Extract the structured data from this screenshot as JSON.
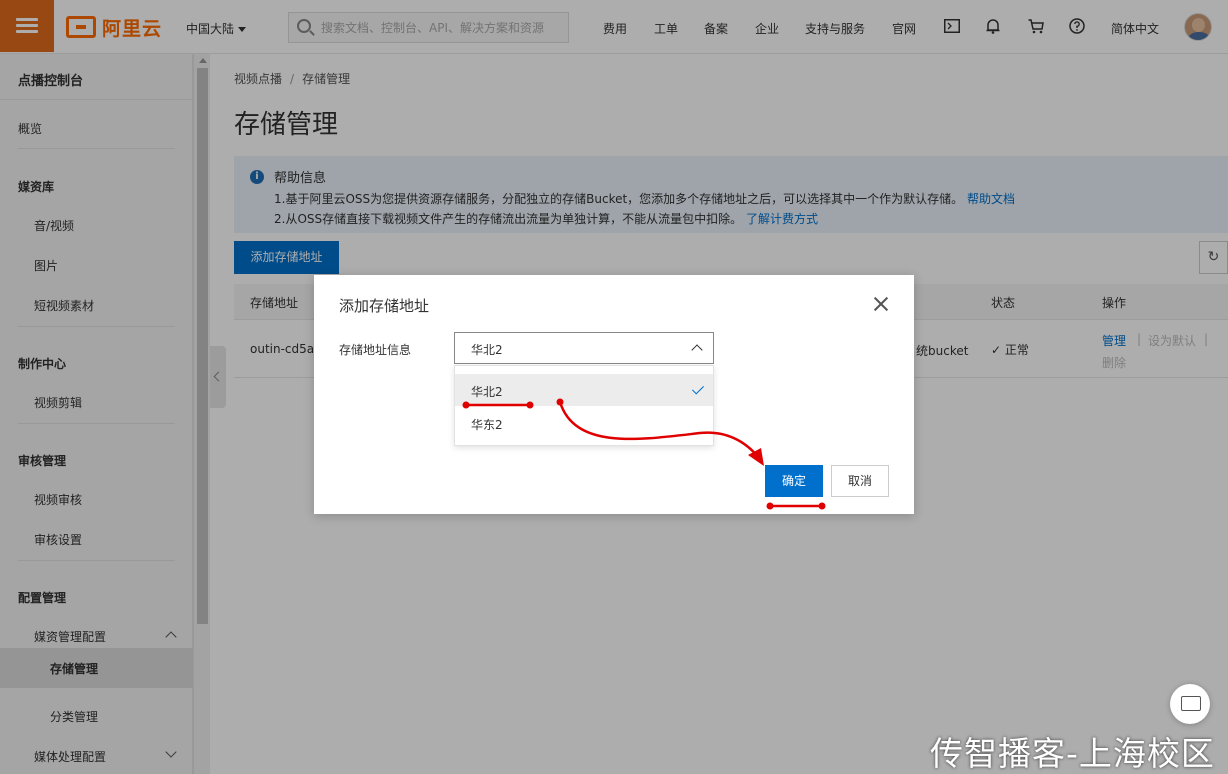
{
  "topbar": {
    "logo_text": "阿里云",
    "region": "中国大陆",
    "search_placeholder": "搜索文档、控制台、API、解决方案和资源",
    "nav": [
      "费用",
      "工单",
      "备案",
      "企业",
      "支持与服务",
      "官网"
    ],
    "language": "简体中文",
    "icons": [
      "terminal-icon",
      "bell-icon",
      "cart-icon",
      "help-icon"
    ]
  },
  "sidebar": {
    "title": "点播控制台",
    "items": [
      {
        "label": "概览",
        "level": "group-plain"
      },
      {
        "label": "媒资库",
        "level": "group"
      },
      {
        "label": "音/视频",
        "level": "l1"
      },
      {
        "label": "图片",
        "level": "l1"
      },
      {
        "label": "短视频素材",
        "level": "l1"
      },
      {
        "label": "制作中心",
        "level": "group"
      },
      {
        "label": "视频剪辑",
        "level": "l1"
      },
      {
        "label": "审核管理",
        "level": "group"
      },
      {
        "label": "视频审核",
        "level": "l1"
      },
      {
        "label": "审核设置",
        "level": "l1"
      },
      {
        "label": "配置管理",
        "level": "group"
      },
      {
        "label": "媒资管理配置",
        "level": "l1"
      },
      {
        "label": "存储管理",
        "level": "l2",
        "active": true
      },
      {
        "label": "分类管理",
        "level": "l2"
      },
      {
        "label": "媒体处理配置",
        "level": "l1"
      }
    ]
  },
  "breadcrumb": [
    "视频点播",
    "存储管理"
  ],
  "page_title": "存储管理",
  "help": {
    "title": "帮助信息",
    "line1": "1.基于阿里云OSS为您提供资源存储服务，分配独立的存储Bucket，您添加多个存储地址之后，可以选择其中一个作为默认存储。",
    "line1_link": "帮助文档",
    "line2": "2.从OSS存储直接下载视频文件产生的存储流出流量为单独计算，不能从流量包中扣除。",
    "line2_link": "了解计费方式"
  },
  "add_button": "添加存储地址",
  "refresh_icon": "refresh-icon",
  "table": {
    "columns": [
      "存储地址",
      "状态",
      "操作"
    ],
    "row": {
      "address": "outin-cd5a4",
      "type_partial": "统bucket",
      "status": "正常",
      "actions": [
        "管理",
        "设为默认",
        "删除"
      ]
    }
  },
  "modal": {
    "title": "添加存储地址",
    "field_label": "存储地址信息",
    "selected": "华北2",
    "options": [
      "华北2",
      "华东2"
    ],
    "ok": "确定",
    "cancel": "取消"
  },
  "watermark": "传智播客-上海校区",
  "colors": {
    "brand_orange": "#ff6a00",
    "primary_blue": "#0070cc",
    "annotation_red": "#e00000"
  }
}
